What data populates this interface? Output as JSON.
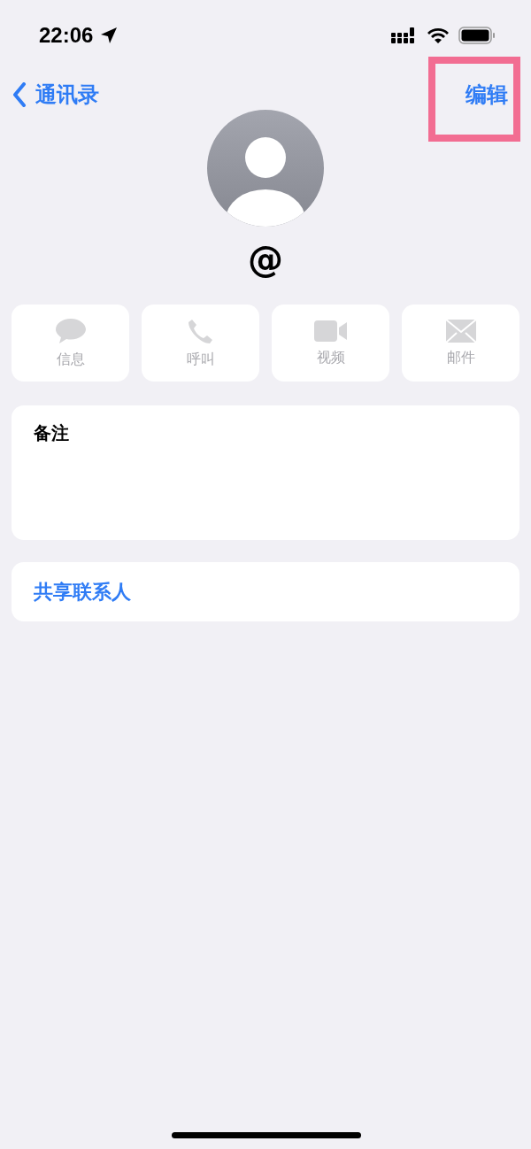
{
  "status_bar": {
    "time": "22:06"
  },
  "nav": {
    "back_label": "通讯录",
    "edit_button": {
      "label": "编辑",
      "highlighted": true
    }
  },
  "contact": {
    "name": "@"
  },
  "actions": [
    {
      "kind": "message",
      "label": "信息",
      "disabled": true
    },
    {
      "kind": "call",
      "label": "呼叫",
      "disabled": true
    },
    {
      "kind": "video",
      "label": "视频",
      "disabled": true
    },
    {
      "kind": "mail",
      "label": "邮件",
      "disabled": true
    }
  ],
  "notes": {
    "label": "备注"
  },
  "share_contact": {
    "label": "共享联系人"
  }
}
